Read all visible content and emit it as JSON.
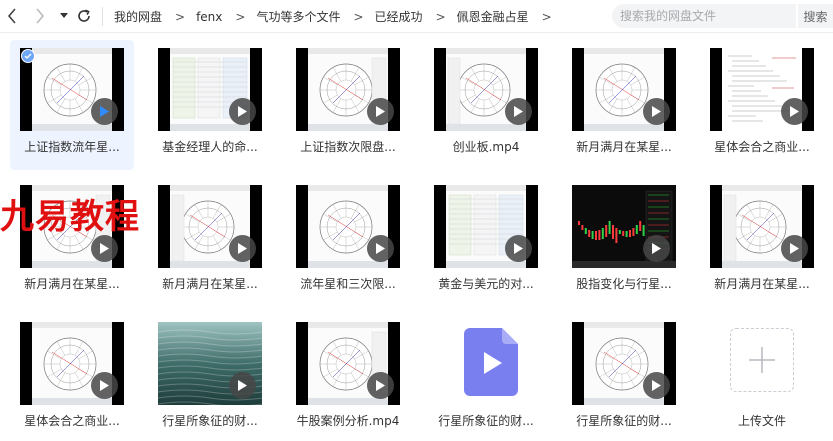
{
  "nav": {
    "back_icon": "chevron-left-icon",
    "forward_icon": "chevron-right-icon",
    "dropdown_icon": "caret-down-icon",
    "refresh_icon": "refresh-icon"
  },
  "breadcrumb": [
    "我的网盘",
    "fenx",
    "气功等多个文件",
    "已经成功",
    "佩恩金融占星"
  ],
  "breadcrumb_separator": ">",
  "search": {
    "placeholder": "搜索我的网盘文件",
    "button_label": "搜索"
  },
  "watermark": "九易教程",
  "files": [
    {
      "name": "上证指数流年星...",
      "kind": "video",
      "selected": true
    },
    {
      "name": "基金经理人的命...",
      "kind": "video"
    },
    {
      "name": "上证指数次限盘...",
      "kind": "video"
    },
    {
      "name": "创业板.mp4",
      "kind": "video"
    },
    {
      "name": "新月满月在某星...",
      "kind": "video"
    },
    {
      "name": "星体会合之商业...",
      "kind": "video"
    },
    {
      "name": "新月满月在某星...",
      "kind": "video"
    },
    {
      "name": "新月满月在某星...",
      "kind": "video"
    },
    {
      "name": "流年星和三次限...",
      "kind": "video"
    },
    {
      "name": "黄金与美元的对...",
      "kind": "video"
    },
    {
      "name": "股指变化与行星...",
      "kind": "video"
    },
    {
      "name": "新月满月在某星...",
      "kind": "video"
    },
    {
      "name": "星体会合之商业...",
      "kind": "video"
    },
    {
      "name": "行星所象征的财...",
      "kind": "video"
    },
    {
      "name": "牛股案例分析.mp4",
      "kind": "video"
    },
    {
      "name": "行星所象征的财...",
      "kind": "video-file"
    },
    {
      "name": "行星所象征的财...",
      "kind": "video"
    }
  ],
  "upload": {
    "label": "上传文件",
    "icon": "plus-icon"
  },
  "colors": {
    "selected_bg": "#eef4ff",
    "checkmark": "#6ea6f8",
    "file_icon": "#7a7ff0",
    "watermark": "#e11010"
  }
}
